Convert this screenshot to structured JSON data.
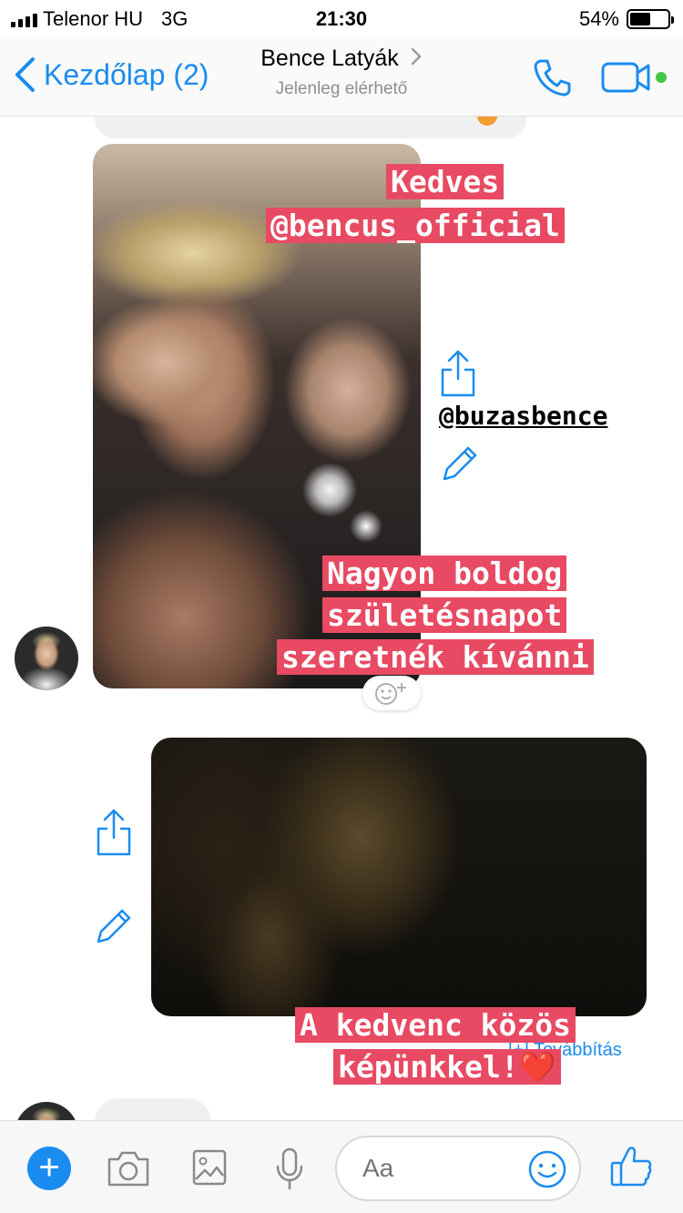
{
  "status_bar": {
    "carrier": "Telenor HU",
    "network": "3G",
    "time": "21:30",
    "battery": "54%",
    "battery_level": 0.54
  },
  "nav": {
    "back_label": "Kezdőlap (2)",
    "contact_name": "Bence Latyák",
    "presence": "Jelenleg elérhető"
  },
  "messages": {
    "story1": {
      "line1": "Kedves",
      "line2": "@bencus_official",
      "mention": "@buzasbence",
      "caption": [
        "Nagyon boldog",
        "születésnapot",
        "szeretnék kívánni"
      ]
    },
    "story2": {
      "caption": [
        "A kedvenc közös",
        "képünkkel!❤️"
      ],
      "link_partial": "[+] Továbbítás"
    }
  },
  "composer": {
    "placeholder": "Aa"
  },
  "colors": {
    "accent": "#1a8cf0",
    "story_highlight": "#e84a63",
    "online_dot": "#44c744"
  }
}
